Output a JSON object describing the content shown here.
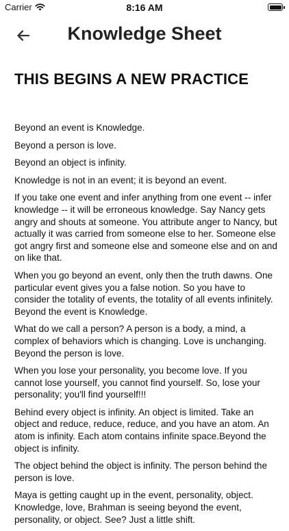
{
  "status_bar": {
    "carrier": "Carrier",
    "time": "8:16 AM"
  },
  "nav": {
    "title": "Knowledge Sheet",
    "back_icon": "arrow-left-icon"
  },
  "heading": "THIS BEGINS A NEW PRACTICE",
  "paragraphs": [
    "Beyond an event is Knowledge.",
    "Beyond a person is love.",
    "Beyond an object is infinity.",
    "Knowledge is not in an event; it is beyond an event.",
    "If you take one event and infer anything from one event -- infer knowledge -- it will be erroneous knowledge. Say Nancy gets angry and shouts at someone. You attribute anger to Nancy, but actually it was carried from someone else to her. Someone else got angry first and someone else and someone else and on and on like that.",
    "When you go beyond an event, only then the truth dawns. One particular event gives you a false notion. So you have to consider the totality of events, the totality of all events infinitely. Beyond the event is Knowledge.",
    "What do we call a person? A person is a body, a mind, a complex of behaviors which is changing. Love is unchanging. Beyond the person is love.",
    "When you lose your personality, you become love. If you cannot lose yourself, you cannot find yourself. So, lose your personality; you'll find yourself!!!",
    "Behind every object is infinity. An object is limited. Take an object and reduce, reduce, reduce, and you have an atom. An atom is infinity. Each atom contains infinite space.Beyond the object is infinity.",
    "The object behind the object is infinity. The person behind the person is love.",
    "Maya is getting caught up in the event, personality, object. Knowledge, love, Brahman is seeing beyond the event, personality, or object. See? Just a little shift."
  ]
}
